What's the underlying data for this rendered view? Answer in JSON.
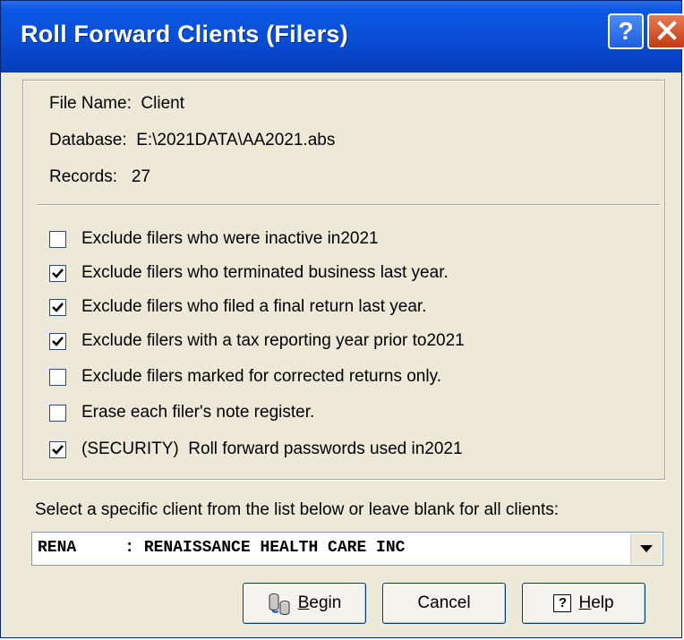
{
  "window": {
    "title": "Roll Forward Clients (Filers)",
    "help_glyph": "?",
    "close_icon": "close-x-icon"
  },
  "info": {
    "file_name_label": "File Name:",
    "file_name_value": "Client",
    "database_label": "Database:",
    "database_value": "E:\\2021DATA\\AA2021.abs",
    "records_label": "Records:",
    "records_value": "27"
  },
  "options": [
    {
      "label": "Exclude filers who were inactive in2021",
      "checked": false
    },
    {
      "label": "Exclude filers who terminated business last year.",
      "checked": true
    },
    {
      "label": "Exclude filers who filed a final return last year.",
      "checked": true
    },
    {
      "label": "Exclude filers with a tax reporting year prior to2021",
      "checked": true
    },
    {
      "label": "Exclude filers marked for corrected returns only.",
      "checked": false
    },
    {
      "label": "Erase each filer's note register.",
      "checked": false
    },
    {
      "label": "(SECURITY)  Roll forward passwords used in2021",
      "checked": true
    }
  ],
  "client_select": {
    "prompt": "Select a specific client from the list below or leave blank for all clients:",
    "value": "RENA     : RENAISSANCE HEALTH CARE INC"
  },
  "buttons": {
    "begin_prefix": "B",
    "begin_rest": "egin",
    "cancel": "Cancel",
    "help_prefix": "H",
    "help_rest": "elp",
    "help_icon_glyph": "?"
  },
  "colors": {
    "title_bar": "#0a4fd6",
    "dialog_bg": "#ece9d8",
    "close_button": "#c33a12"
  }
}
